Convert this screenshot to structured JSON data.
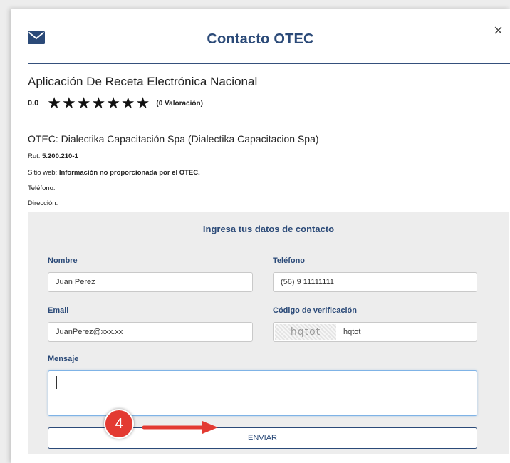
{
  "modal": {
    "title": "Contacto OTEC",
    "close_label": "×",
    "icons": {
      "header": "envelope-icon",
      "close": "close-icon"
    }
  },
  "course": {
    "name": "Aplicación De Receta Electrónica Nacional",
    "rating_value": "0.0",
    "stars": "★★★★★★★",
    "rating_count": "(0 Valoración)"
  },
  "otec": {
    "name": "OTEC: Dialectika Capacitación Spa (Dialectika Capacitacion Spa)",
    "rut_label": "Rut:",
    "rut_value": "5.200.210-1",
    "website_label": "Sitio web:",
    "website_value": "Información no proporcionada por el OTEC.",
    "phone_label": "Teléfono:",
    "address_label": "Dirección:"
  },
  "form": {
    "heading": "Ingresa tus datos de contacto",
    "nombre_label": "Nombre",
    "nombre_value": "Juan Perez",
    "telefono_label": "Teléfono",
    "telefono_value": "(56) 9 11111111",
    "email_label": "Email",
    "email_value": "JuanPerez@xxx.xx",
    "codigo_label": "Código de verificación",
    "captcha_image_text": "hqtot",
    "codigo_value": "hqtot",
    "mensaje_label": "Mensaje",
    "mensaje_value": "",
    "submit_label": "ENVIAR"
  },
  "annotation": {
    "step_number": "4",
    "color": "#e33a32"
  },
  "colors": {
    "accent": "#2b4a78",
    "form_background": "#ededed",
    "focus_border": "#7fb3e6"
  }
}
